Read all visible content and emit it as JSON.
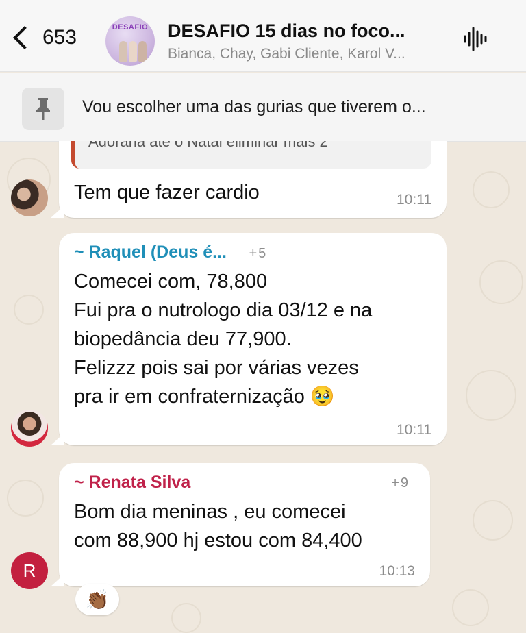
{
  "header": {
    "back_count": "653",
    "avatar_text": "DESAFIO",
    "title": "DESAFIO 15 dias no foco...",
    "subtitle": "Bianca, Chay, Gabi Cliente, Karol V...",
    "icons": {
      "back": "chevron-left-icon",
      "call": "audio-wave-icon"
    }
  },
  "pinned": {
    "icon": "pin-icon",
    "text": "Vou escolher uma das gurias que tiverem o..."
  },
  "messages": [
    {
      "quoted_text": "Adoraria até o Natal eliminar mais 2",
      "body": "Tem que fazer cardio",
      "time": "10:11"
    },
    {
      "sender": "~ Raquel (Deus é...",
      "sender_color": "#1f8fb8",
      "phone": "+5",
      "lines": [
        "Comecei com, 78,800",
        "Fui pra o nutrologo dia 03/12 e na",
        "biopedância deu 77,900.",
        "Felizzz pois sai por várias vezes",
        "pra ir em confraternização 🥹"
      ],
      "time": "10:11"
    },
    {
      "sender": "~ Renata Silva",
      "sender_color": "#c0224a",
      "phone": "+9",
      "lines": [
        "Bom dia meninas , eu comecei",
        "com 88,900 hj estou com 84,400"
      ],
      "time": "10:13",
      "avatar_initial": "R",
      "reaction": "👏🏾"
    }
  ]
}
